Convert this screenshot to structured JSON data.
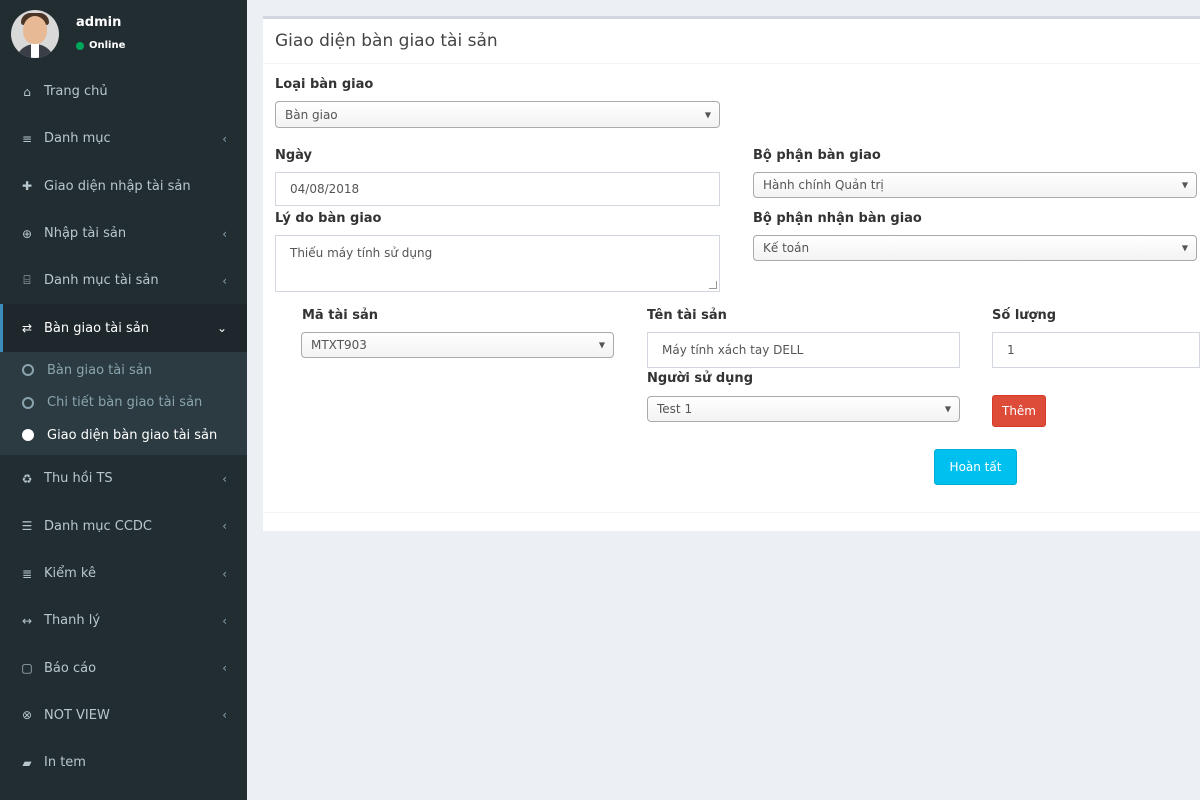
{
  "user": {
    "name": "admin",
    "status": "Online"
  },
  "sidebar": {
    "items": [
      {
        "label": "Trang chủ",
        "icon": "home-icon",
        "glyph": "⌂",
        "has_chevron": false
      },
      {
        "label": "Danh mục",
        "icon": "bars-icon",
        "glyph": "≡",
        "has_chevron": true
      },
      {
        "label": "Giao diện nhập tài sản",
        "icon": "plus-icon",
        "glyph": "✚",
        "has_chevron": false
      },
      {
        "label": "Nhập tài sản",
        "icon": "plus-circle-icon",
        "glyph": "⊕",
        "has_chevron": true
      },
      {
        "label": "Danh mục tài sản",
        "icon": "bank-icon",
        "glyph": "⌸",
        "has_chevron": true
      }
    ],
    "active": {
      "label": "Bàn giao tài sản",
      "icon": "exchange-icon",
      "glyph": "⇄",
      "chevron": "⌄"
    },
    "submenu": [
      {
        "label": "Bàn giao tài sản"
      },
      {
        "label": "Chi tiết bàn giao tài sản"
      },
      {
        "label": "Giao diện bàn giao tài sản"
      }
    ],
    "items_after": [
      {
        "label": "Thu hồi TS",
        "icon": "recycle-icon",
        "glyph": "♻",
        "has_chevron": true
      },
      {
        "label": "Danh mục CCDC",
        "icon": "server-icon",
        "glyph": "☰",
        "has_chevron": true
      },
      {
        "label": "Kiểm kê",
        "icon": "database-icon",
        "glyph": "≣",
        "has_chevron": true
      },
      {
        "label": "Thanh lý",
        "icon": "arrows-h-icon",
        "glyph": "↔",
        "has_chevron": true
      },
      {
        "label": "Báo cáo",
        "icon": "file-icon",
        "glyph": "▢",
        "has_chevron": true
      },
      {
        "label": "NOT VIEW",
        "icon": "times-circle-icon",
        "glyph": "⊗",
        "has_chevron": true
      },
      {
        "label": "In tem",
        "icon": "book-icon",
        "glyph": "▰",
        "has_chevron": false
      }
    ],
    "chevron_glyph": "‹"
  },
  "form": {
    "title": "Giao diện bàn giao tài sản",
    "loai_ban_giao": {
      "label": "Loại bàn giao",
      "value": "Bàn giao"
    },
    "ngay": {
      "label": "Ngày",
      "value": "04/08/2018"
    },
    "bo_phan_ban_giao": {
      "label": "Bộ phận bàn giao",
      "value": "Hành chính Quản trị"
    },
    "ly_do": {
      "label": "Lý do bàn giao",
      "value": "Thiếu máy tính sử dụng"
    },
    "bo_phan_nhan": {
      "label": "Bộ phận nhận bàn giao",
      "value": "Kế toán"
    },
    "ma_tai_san": {
      "label": "Mã tài sản",
      "value": "MTXT903"
    },
    "ten_tai_san": {
      "label": "Tên tài sản",
      "value": "Máy tính xách tay DELL"
    },
    "so_luong": {
      "label": "Số lượng",
      "value": "1"
    },
    "nguoi_su_dung": {
      "label": "Người sử dụng",
      "value": "Test 1"
    },
    "add_button": "Thêm",
    "done_button": "Hoàn tất",
    "select_arrow": "▼"
  }
}
